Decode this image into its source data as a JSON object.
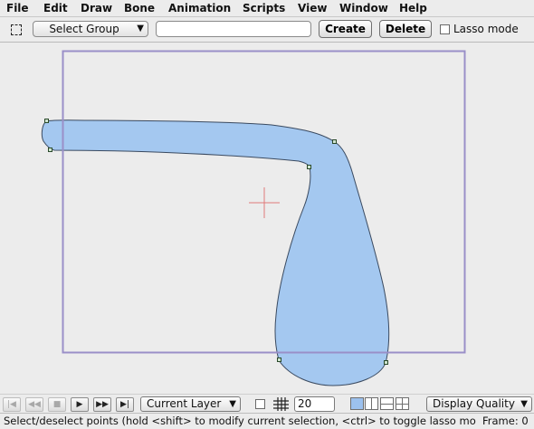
{
  "menu": {
    "items": [
      "File",
      "Edit",
      "Draw",
      "Bone",
      "Animation",
      "Scripts",
      "View",
      "Window",
      "Help"
    ]
  },
  "toolbar": {
    "tool_icon": "lasso-select-icon",
    "group_select": "Select Group",
    "name_value": "",
    "create_label": "Create",
    "delete_label": "Delete",
    "lasso_label": "Lasso mode",
    "lasso_checked": false
  },
  "canvas": {
    "shape_fill": "#a4c8f0",
    "frame_color": "#9a8fc8",
    "origin_color": "#e07a7a"
  },
  "controls": {
    "transport_icons": [
      "rewind-icon",
      "step-back-icon",
      "stop-icon",
      "play-icon",
      "step-forward-icon",
      "fast-forward-icon"
    ],
    "layer_select": "Current Layer",
    "grid_size": "20",
    "quality_select": "Display Quality"
  },
  "status": {
    "message": "Select/deselect points (hold <shift> to modify current selection, <ctrl> to toggle lasso mo",
    "frame": "Frame: 0"
  }
}
